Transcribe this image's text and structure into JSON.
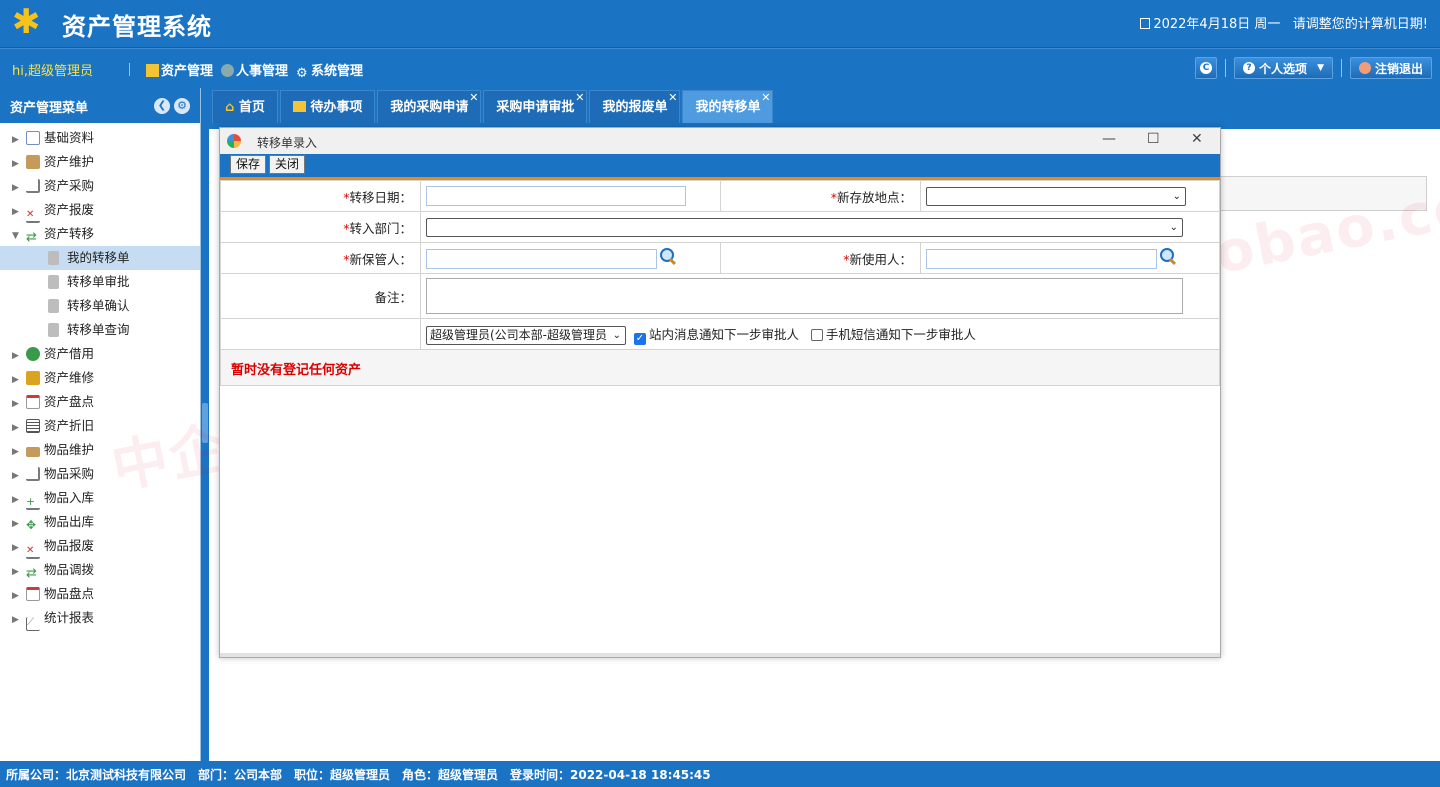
{
  "header": {
    "title": "资产管理系统",
    "date_text": "2022年4月18日 周一",
    "date_hint": "请调整您的计算机日期!"
  },
  "nav": {
    "greeting": "hi,超级管理员",
    "menus": [
      "资产管理",
      "人事管理",
      "系统管理"
    ],
    "personal_options": "个人选项",
    "logout": "注销退出"
  },
  "sidebar": {
    "title": "资产管理菜单",
    "items": [
      {
        "label": "基础资料",
        "color": "#6e8fbf"
      },
      {
        "label": "资产维护",
        "color": "#c59a5b"
      },
      {
        "label": "资产采购",
        "color": "#7a7a7a"
      },
      {
        "label": "资产报废",
        "color": "#b44"
      },
      {
        "label": "资产转移",
        "color": "#3a9a4a"
      },
      {
        "label": "资产借用",
        "color": "#3a9a4a"
      },
      {
        "label": "资产维修",
        "color": "#d9a420"
      },
      {
        "label": "资产盘点",
        "color": "#cc3a3a"
      },
      {
        "label": "资产折旧",
        "color": "#555"
      },
      {
        "label": "物品维护",
        "color": "#c59a5b"
      },
      {
        "label": "物品采购",
        "color": "#7a7a7a"
      },
      {
        "label": "物品入库",
        "color": "#3a9a4a"
      },
      {
        "label": "物品出库",
        "color": "#3a9a4a"
      },
      {
        "label": "物品报废",
        "color": "#b44"
      },
      {
        "label": "物品调拨",
        "color": "#3a9a4a"
      },
      {
        "label": "物品盘点",
        "color": "#cc3a3a"
      },
      {
        "label": "统计报表",
        "color": "#6e8fbf"
      }
    ],
    "transfer_children": [
      "我的转移单",
      "转移单审批",
      "转移单确认",
      "转移单查询"
    ]
  },
  "tabs": [
    {
      "label": "首页",
      "closable": false
    },
    {
      "label": "待办事项",
      "closable": false
    },
    {
      "label": "我的采购申请",
      "closable": true
    },
    {
      "label": "采购申请审批",
      "closable": true
    },
    {
      "label": "我的报废单",
      "closable": true
    },
    {
      "label": "我的转移单",
      "closable": true
    }
  ],
  "dialog": {
    "title": "转移单录入",
    "save": "保存",
    "close": "关闭",
    "fields": {
      "transfer_date": "转移日期：",
      "new_location": "新存放地点：",
      "dept_in": "转入部门：",
      "new_keeper": "新保管人：",
      "new_user": "新使用人：",
      "remark": "备注："
    },
    "approver": "超级管理员(公司本部-超级管理员",
    "notify_internal": "站内消息通知下一步审批人",
    "notify_sms": "手机短信通知下一步审批人",
    "no_asset": "暂时没有登记任何资产"
  },
  "status_bar": "所属公司：北京测试科技有限公司　部门：公司本部　职位：超级管理员　角色：超级管理员　登录时间：2022-04-18 18:45:45",
  "watermark": "中企软件-https://shop113983775.taobao.com"
}
